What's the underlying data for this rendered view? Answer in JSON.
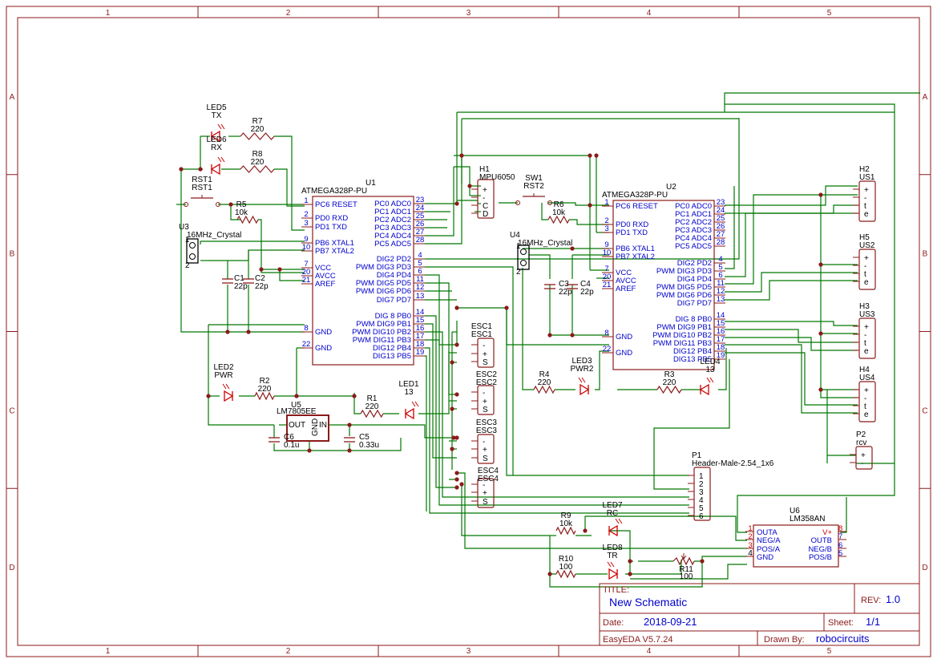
{
  "frame": {
    "columns": [
      "1",
      "2",
      "3",
      "4",
      "5"
    ],
    "rows": [
      "A",
      "B",
      "C",
      "D"
    ]
  },
  "title_block": {
    "title_label": "TITLE:",
    "title": "New Schematic",
    "rev_label": "REV:",
    "rev": "1.0",
    "date_label": "Date:",
    "date": "2018-09-21",
    "sheet_label": "Sheet:",
    "sheet": "1/1",
    "tool": "EasyEDA V5.7.24",
    "drawn_label": "Drawn By:",
    "drawn_by": "robocircuits"
  },
  "components": {
    "u1": {
      "ref": "U1",
      "value": "ATMEGA328P-PU",
      "left_pins": [
        {
          "num": "1",
          "name": "PC6 RESET"
        },
        {
          "num": "2",
          "name": "PD0 RXD"
        },
        {
          "num": "3",
          "name": "PD1 TXD"
        },
        {
          "num": "9",
          "name": "PB6 XTAL1"
        },
        {
          "num": "10",
          "name": "PB7 XTAL2"
        },
        {
          "num": "7",
          "name": "VCC"
        },
        {
          "num": "20",
          "name": "AVCC"
        },
        {
          "num": "21",
          "name": "AREF"
        },
        {
          "num": "8",
          "name": "GND"
        },
        {
          "num": "22",
          "name": "GND"
        }
      ],
      "right_pins": [
        {
          "num": "23",
          "name": "PC0 ADC0"
        },
        {
          "num": "24",
          "name": "PC1 ADC1"
        },
        {
          "num": "25",
          "name": "PC2 ADC2"
        },
        {
          "num": "26",
          "name": "PC3 ADC3"
        },
        {
          "num": "27",
          "name": "PC4 ADC4"
        },
        {
          "num": "28",
          "name": "PC5 ADC5"
        },
        {
          "num": "4",
          "name": "DIG2 PD2"
        },
        {
          "num": "5",
          "name": "PWM DIG3 PD3"
        },
        {
          "num": "6",
          "name": "DIG4 PD4"
        },
        {
          "num": "11",
          "name": "PWM DIG5 PD5"
        },
        {
          "num": "12",
          "name": "PWM DIG6 PD6"
        },
        {
          "num": "13",
          "name": "DIG7 PD7"
        },
        {
          "num": "14",
          "name": "DIG 8 PB0"
        },
        {
          "num": "15",
          "name": "PWM DIG9 PB1"
        },
        {
          "num": "16",
          "name": "PWM DIG10 PB2"
        },
        {
          "num": "17",
          "name": "PWM DIG11 PB3"
        },
        {
          "num": "18",
          "name": "DIG12 PB4"
        },
        {
          "num": "19",
          "name": "DIG13 PB5"
        }
      ]
    },
    "u2": {
      "ref": "U2",
      "value": "ATMEGA328P-PU",
      "left_pins": [
        {
          "num": "1",
          "name": "PC6 RESET"
        },
        {
          "num": "2",
          "name": "PD0 RXD"
        },
        {
          "num": "3",
          "name": "PD1 TXD"
        },
        {
          "num": "9",
          "name": "PB6 XTAL1"
        },
        {
          "num": "10",
          "name": "PB7 XTAL2"
        },
        {
          "num": "7",
          "name": "VCC"
        },
        {
          "num": "20",
          "name": "AVCC"
        },
        {
          "num": "21",
          "name": "AREF"
        },
        {
          "num": "8",
          "name": "GND"
        },
        {
          "num": "22",
          "name": "GND"
        }
      ],
      "right_pins": [
        {
          "num": "23",
          "name": "PC0 ADC0"
        },
        {
          "num": "24",
          "name": "PC1 ADC1"
        },
        {
          "num": "25",
          "name": "PC2 ADC2"
        },
        {
          "num": "26",
          "name": "PC3 ADC3"
        },
        {
          "num": "27",
          "name": "PC4 ADC4"
        },
        {
          "num": "28",
          "name": "PC5 ADC5"
        },
        {
          "num": "4",
          "name": "DIG2 PD2"
        },
        {
          "num": "5",
          "name": "PWM DIG3 PD3"
        },
        {
          "num": "6",
          "name": "DIG4 PD4"
        },
        {
          "num": "11",
          "name": "PWM DIG5 PD5"
        },
        {
          "num": "12",
          "name": "PWM DIG6 PD6"
        },
        {
          "num": "13",
          "name": "DIG7 PD7"
        },
        {
          "num": "14",
          "name": "DIG 8 PB0"
        },
        {
          "num": "15",
          "name": "PWM DIG9 PB1"
        },
        {
          "num": "16",
          "name": "PWM DIG10 PB2"
        },
        {
          "num": "17",
          "name": "PWM DIG11 PB3"
        },
        {
          "num": "18",
          "name": "DIG12 PB4"
        },
        {
          "num": "19",
          "name": "DIG13 PB5"
        }
      ]
    },
    "u6": {
      "ref": "U6",
      "value": "LM358AN",
      "left_pins": [
        {
          "num": "1",
          "name": "OUTA"
        },
        {
          "num": "2",
          "name": "NEG/A"
        },
        {
          "num": "3",
          "name": "POS/A"
        },
        {
          "num": "4",
          "name": "GND"
        }
      ],
      "right_pins": [
        {
          "num": "8",
          "name": "V+"
        },
        {
          "num": "7",
          "name": "OUTB"
        },
        {
          "num": "6",
          "name": "NEG/B"
        },
        {
          "num": "5",
          "name": "POS/B"
        }
      ]
    },
    "u5": {
      "ref": "U5",
      "value": "LM7805EE",
      "out": "OUT",
      "in": "IN",
      "gnd": "GND"
    },
    "h1": {
      "ref": "H1",
      "value": "MPU6050",
      "pins": [
        "+",
        "-",
        "C",
        "D"
      ]
    },
    "sw1": {
      "ref": "SW1",
      "value": "RST2"
    },
    "rst1": {
      "ref": "RST1",
      "value": "RST1"
    },
    "u3": {
      "ref": "U3",
      "value": "16MHz_Crystal",
      "p1": "1",
      "p2": "2"
    },
    "u4": {
      "ref": "U4",
      "value": "16MHz_Crystal",
      "p1": "1",
      "p2": "2"
    },
    "led5": {
      "ref": "LED5",
      "value": "TX"
    },
    "led6": {
      "ref": "LED6",
      "value": "RX"
    },
    "r7": {
      "ref": "R7",
      "value": "220"
    },
    "r8": {
      "ref": "R8",
      "value": "220"
    },
    "r5": {
      "ref": "R5",
      "value": "10k"
    },
    "r6": {
      "ref": "R6",
      "value": "10k"
    },
    "c1": {
      "ref": "C1",
      "value": "22p"
    },
    "c2": {
      "ref": "C2",
      "value": "22p"
    },
    "c3": {
      "ref": "C3",
      "value": "22p"
    },
    "c4": {
      "ref": "C4",
      "value": "22p"
    },
    "led2": {
      "ref": "LED2",
      "value": "PWR"
    },
    "r2": {
      "ref": "R2",
      "value": "220"
    },
    "r1": {
      "ref": "R1",
      "value": "220"
    },
    "led1": {
      "ref": "LED1",
      "value": "13"
    },
    "c6": {
      "ref": "C6",
      "value": "0.1u"
    },
    "c5": {
      "ref": "C5",
      "value": "0.33u"
    },
    "led3": {
      "ref": "LED3",
      "value": "PWR2"
    },
    "r4": {
      "ref": "R4",
      "value": "220"
    },
    "r3": {
      "ref": "R3",
      "value": "220"
    },
    "led4": {
      "ref": "LED4",
      "value": "13"
    },
    "esc1": {
      "ref": "ESC1",
      "value": "ESC1",
      "pins": [
        "-",
        "+",
        "S"
      ]
    },
    "esc2": {
      "ref": "ESC2",
      "value": "ESC2",
      "pins": [
        "-",
        "+",
        "S"
      ]
    },
    "esc3": {
      "ref": "ESC3",
      "value": "ESC3",
      "pins": [
        "-",
        "+",
        "S"
      ]
    },
    "esc4": {
      "ref": "ESC4",
      "value": "ESC4",
      "pins": [
        "-",
        "+",
        "S"
      ]
    },
    "h2": {
      "ref": "H2",
      "value": "US1",
      "pins": [
        "+",
        "-",
        "t",
        "e"
      ]
    },
    "h5": {
      "ref": "H5",
      "value": "US2",
      "pins": [
        "+",
        "-",
        "t",
        "e"
      ]
    },
    "h3": {
      "ref": "H3",
      "value": "US3",
      "pins": [
        "+",
        "-",
        "t",
        "e"
      ]
    },
    "h4": {
      "ref": "H4",
      "value": "US4",
      "pins": [
        "+",
        "-",
        "t",
        "e"
      ]
    },
    "p2": {
      "ref": "P2",
      "value": "rcv",
      "pins": [
        "+",
        "-"
      ]
    },
    "p1": {
      "ref": "P1",
      "value": "Header-Male-2.54_1x6",
      "pins": [
        "1",
        "2",
        "3",
        "4",
        "5",
        "6"
      ]
    },
    "led7": {
      "ref": "LED7",
      "value": "RC"
    },
    "led8": {
      "ref": "LED8",
      "value": "TR"
    },
    "r9": {
      "ref": "R9",
      "value": "10k"
    },
    "r10": {
      "ref": "R10",
      "value": "100"
    },
    "r11": {
      "ref": "R11",
      "value": "100"
    }
  }
}
